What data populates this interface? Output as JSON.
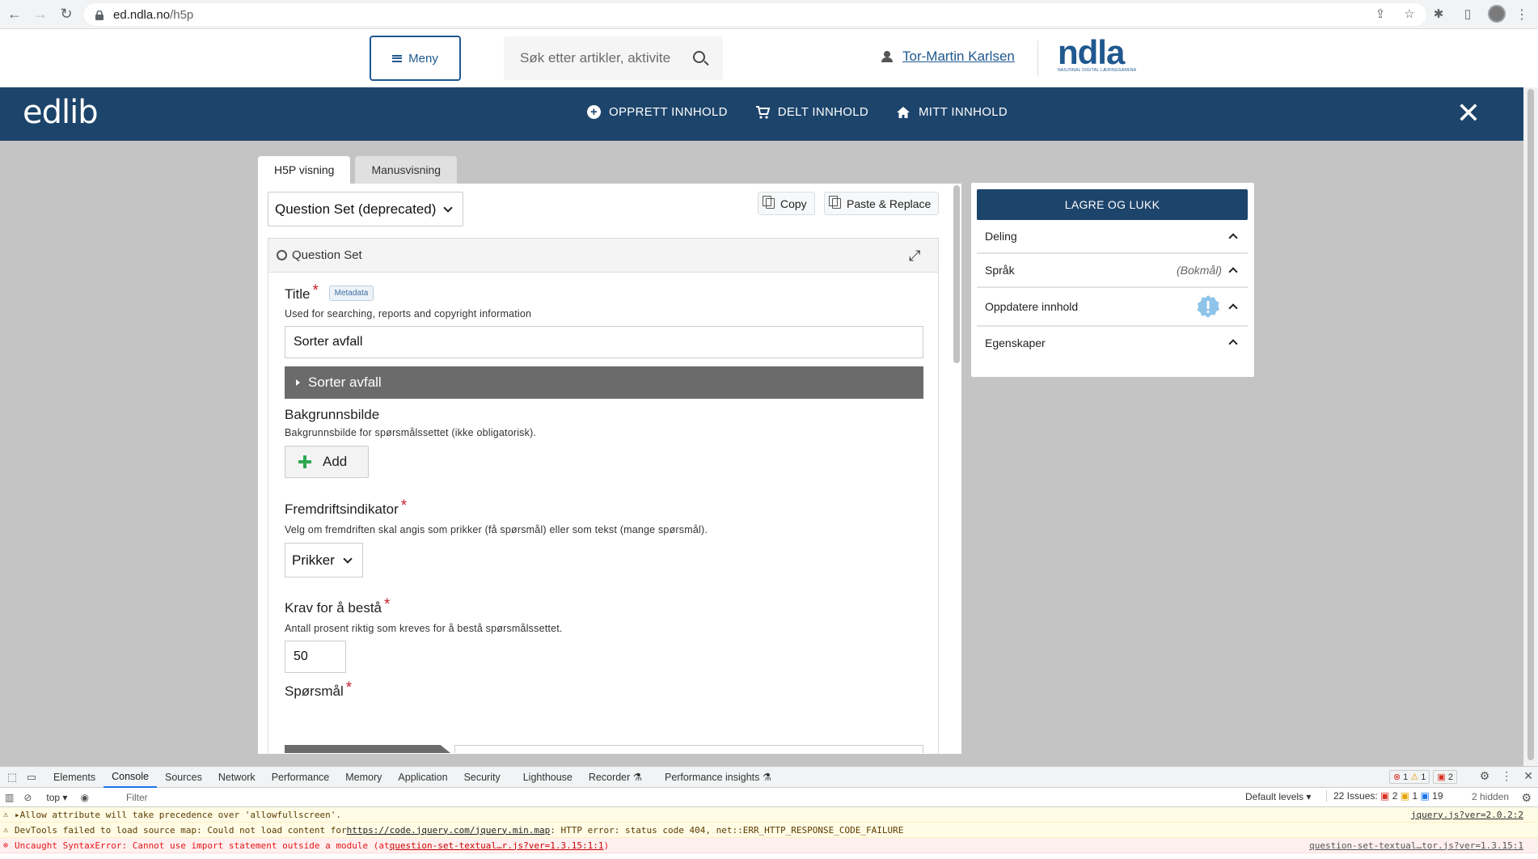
{
  "browser": {
    "url_host": "ed.ndla.no",
    "url_path": "/h5p"
  },
  "ndla": {
    "menu_label": "Meny",
    "search_placeholder": "Søk etter artikler, aktivite",
    "user_name": "Tor-Martin Karlsen",
    "logo_word": "ndla",
    "logo_tagline": "NASJONAL DIGITAL LÆRINGSARENA"
  },
  "edlib": {
    "logo": "edlib",
    "nav": [
      {
        "label": "OPPRETT INNHOLD",
        "icon": "plus-circle-icon"
      },
      {
        "label": "DELT INNHOLD",
        "icon": "cart-icon"
      },
      {
        "label": "MITT INNHOLD",
        "icon": "home-icon"
      }
    ],
    "close_icon": "close-icon"
  },
  "tabs": [
    {
      "label": "H5P visning",
      "active": true
    },
    {
      "label": "Manusvisning",
      "active": false
    }
  ],
  "editor": {
    "content_type": "Question Set (deprecated)",
    "copy_label": "Copy",
    "paste_label": "Paste & Replace",
    "panel_title": "Question Set",
    "title_field": {
      "label": "Title",
      "metadata_label": "Metadata",
      "description": "Used for searching, reports and copyright information",
      "value": "Sorter avfall"
    },
    "group_label": "Sorter avfall",
    "background": {
      "label": "Bakgrunnsbilde",
      "description": "Bakgrunnsbilde for spørsmålssettet (ikke obligatorisk).",
      "add_label": "Add"
    },
    "progress": {
      "label": "Fremdriftsindikator",
      "description": "Velg om fremdriften skal angis som prikker (få spørsmål) eller som tekst (mange spørsmål).",
      "value": "Prikker"
    },
    "pass": {
      "label": "Krav for å bestå",
      "description": "Antall prosent riktig som kreves for å bestå spørsmålssettet.",
      "value": "50"
    },
    "questions": {
      "label": "Spørsmål"
    }
  },
  "sidebar": {
    "save_label": "LAGRE OG LUKK",
    "rows": [
      {
        "label": "Deling"
      },
      {
        "label": "Språk",
        "note": "(Bokmål)"
      },
      {
        "label": "Oppdatere innhold"
      },
      {
        "label": "Egenskaper"
      }
    ]
  },
  "devtools": {
    "tabs": [
      "Elements",
      "Console",
      "Sources",
      "Network",
      "Performance",
      "Memory",
      "Application",
      "Security",
      "Lighthouse",
      "Recorder ⚗",
      "Performance insights ⚗"
    ],
    "active_tab": "Console",
    "counters": {
      "errors": "1",
      "warnings": "1",
      "issues": "2"
    },
    "context": "top ▾",
    "filter_placeholder": "Filter",
    "levels": "Default levels ▾",
    "issues_label": "22 Issues:",
    "issues_counts": {
      "errors": "2",
      "warnings": "1",
      "info": "19"
    },
    "hidden_label": "2 hidden",
    "logs": [
      {
        "level": "warn",
        "text": "▸Allow attribute will take precedence over 'allowfullscreen'.",
        "source": "jquery.js?ver=2.0.2:2"
      },
      {
        "level": "warn",
        "text_before": "DevTools failed to load source map: Could not load content for ",
        "link": "https://code.jquery.com/jquery.min.map",
        "text_after": ": HTTP error: status code 404, net::ERR_HTTP_RESPONSE_CODE_FAILURE",
        "source": ""
      },
      {
        "level": "err",
        "text_before": "Uncaught SyntaxError: Cannot use import statement outside a module (at ",
        "link": "question-set-textual…r.js?ver=1.3.15:1:1",
        "text_after": ")",
        "source": "question-set-textual…tor.js?ver=1.3.15:1"
      }
    ]
  }
}
